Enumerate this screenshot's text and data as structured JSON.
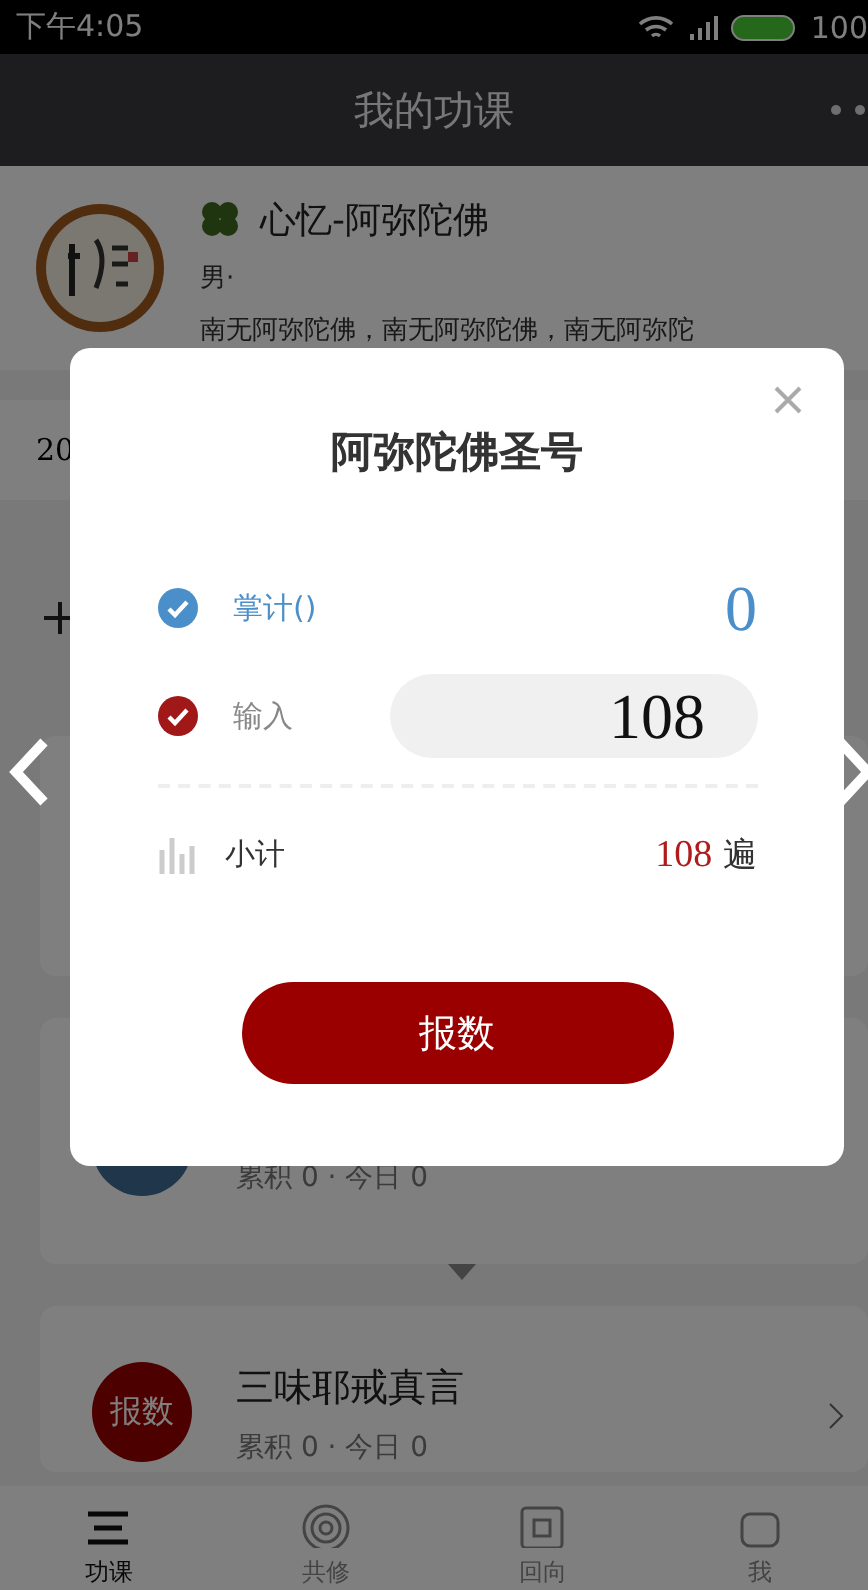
{
  "status_bar": {
    "time": "下午4:05",
    "battery": "100"
  },
  "header": {
    "title": "我的功课"
  },
  "profile": {
    "name": "心忆-阿弥陀佛",
    "gender": "男·",
    "motto": "南无阿弥陀佛，南无阿弥陀佛，南无阿弥陀"
  },
  "date_row": {
    "text": "20"
  },
  "cards": [
    {
      "kind": "plain"
    },
    {
      "kind": "stats",
      "stats": "累积 0 · 今日 0"
    },
    {
      "kind": "full",
      "badge": "报数",
      "title": "三味耶戒真言",
      "stats": "累积 0 · 今日 0"
    }
  ],
  "tabs": [
    {
      "label": "功课",
      "selected": true
    },
    {
      "label": "共修",
      "selected": false
    },
    {
      "label": "回向",
      "selected": false
    },
    {
      "label": "我",
      "selected": false
    }
  ],
  "dialog": {
    "title": "阿弥陀佛圣号",
    "modes": [
      {
        "kind": "counter",
        "label": "掌计()",
        "checked": true,
        "value": "0",
        "color": "#4a8fc9"
      },
      {
        "kind": "input",
        "label": "输入",
        "checked": true,
        "value": "108",
        "color": "#a01818"
      }
    ],
    "subtotal": {
      "label": "小计",
      "value": "108",
      "unit": "遍"
    },
    "submit": "报数"
  }
}
